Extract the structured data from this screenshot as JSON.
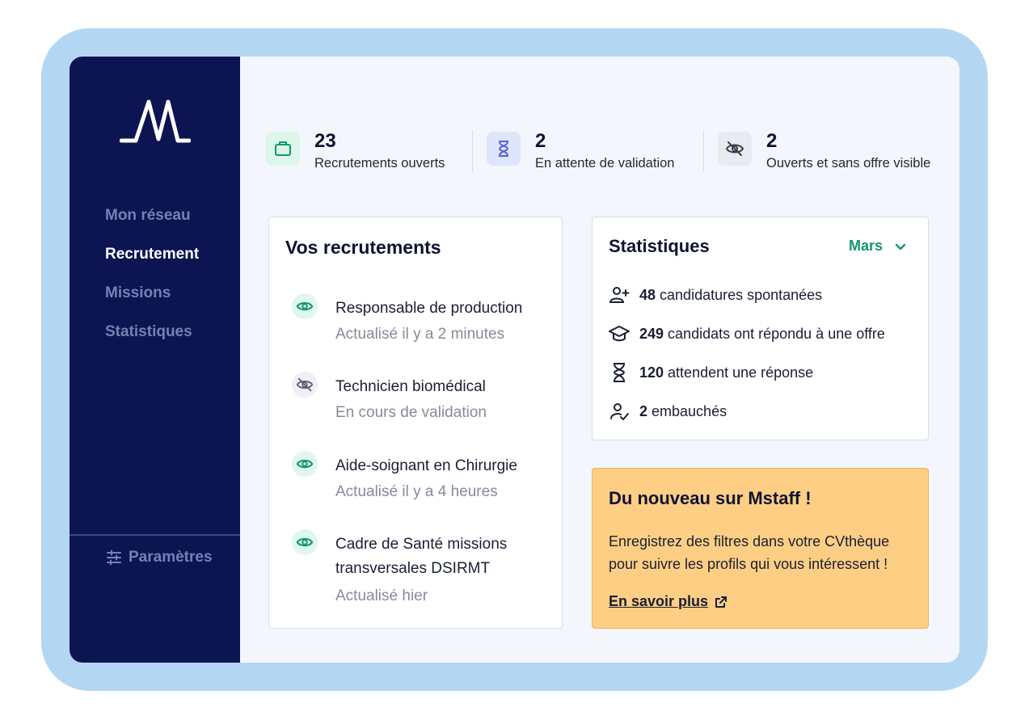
{
  "sidebar": {
    "nav": [
      {
        "label": "Mon réseau",
        "active": false
      },
      {
        "label": "Recrutement",
        "active": true
      },
      {
        "label": "Missions",
        "active": false
      },
      {
        "label": "Statistiques",
        "active": false
      }
    ],
    "settings_label": "Paramètres"
  },
  "kpis": [
    {
      "value": "23",
      "label": "Recrutements ouverts",
      "icon": "briefcase-icon",
      "bg": "#ddf6ea",
      "fg": "#12986a"
    },
    {
      "value": "2",
      "label": "En attente de validation",
      "icon": "hourglass-icon",
      "bg": "#dfe5fa",
      "fg": "#5864d9"
    },
    {
      "value": "2",
      "label": "Ouverts et sans offre visible",
      "icon": "eye-off-icon",
      "bg": "#e8eaef",
      "fg": "#3a3f4f"
    }
  ],
  "recruitments": {
    "title": "Vos recrutements",
    "items": [
      {
        "title": "Responsable de production",
        "status": "Actualisé il y a 2 minutes",
        "visible": true
      },
      {
        "title": "Technicien biomédical",
        "status": "En cours de validation",
        "visible": false
      },
      {
        "title": "Aide-soignant en Chirurgie",
        "status": "Actualisé il y a 4 heures",
        "visible": true
      },
      {
        "title": "Cadre de Santé missions transversales DSIRMT",
        "status": "Actualisé hier",
        "visible": true
      }
    ]
  },
  "stats": {
    "title": "Statistiques",
    "month": "Mars",
    "rows": [
      {
        "value": "48",
        "label": "candidatures spontanées",
        "icon": "user-plus-icon"
      },
      {
        "value": "249",
        "label": "candidats ont répondu à une offre",
        "icon": "graduation-cap-icon"
      },
      {
        "value": "120",
        "label": "attendent une réponse",
        "icon": "hourglass-icon"
      },
      {
        "value": "2",
        "label": "embauchés",
        "icon": "user-check-icon"
      }
    ]
  },
  "news": {
    "title": "Du nouveau sur Mstaff !",
    "body": "Enregistrez des filtres dans votre CVthèque pour suivre les profils qui vous intéressent !",
    "link_label": "En savoir plus"
  },
  "colors": {
    "sidebar_bg": "#0c1452",
    "accent_green": "#12986a",
    "news_bg": "#fece84",
    "frame_bg": "#b3d7f3"
  }
}
